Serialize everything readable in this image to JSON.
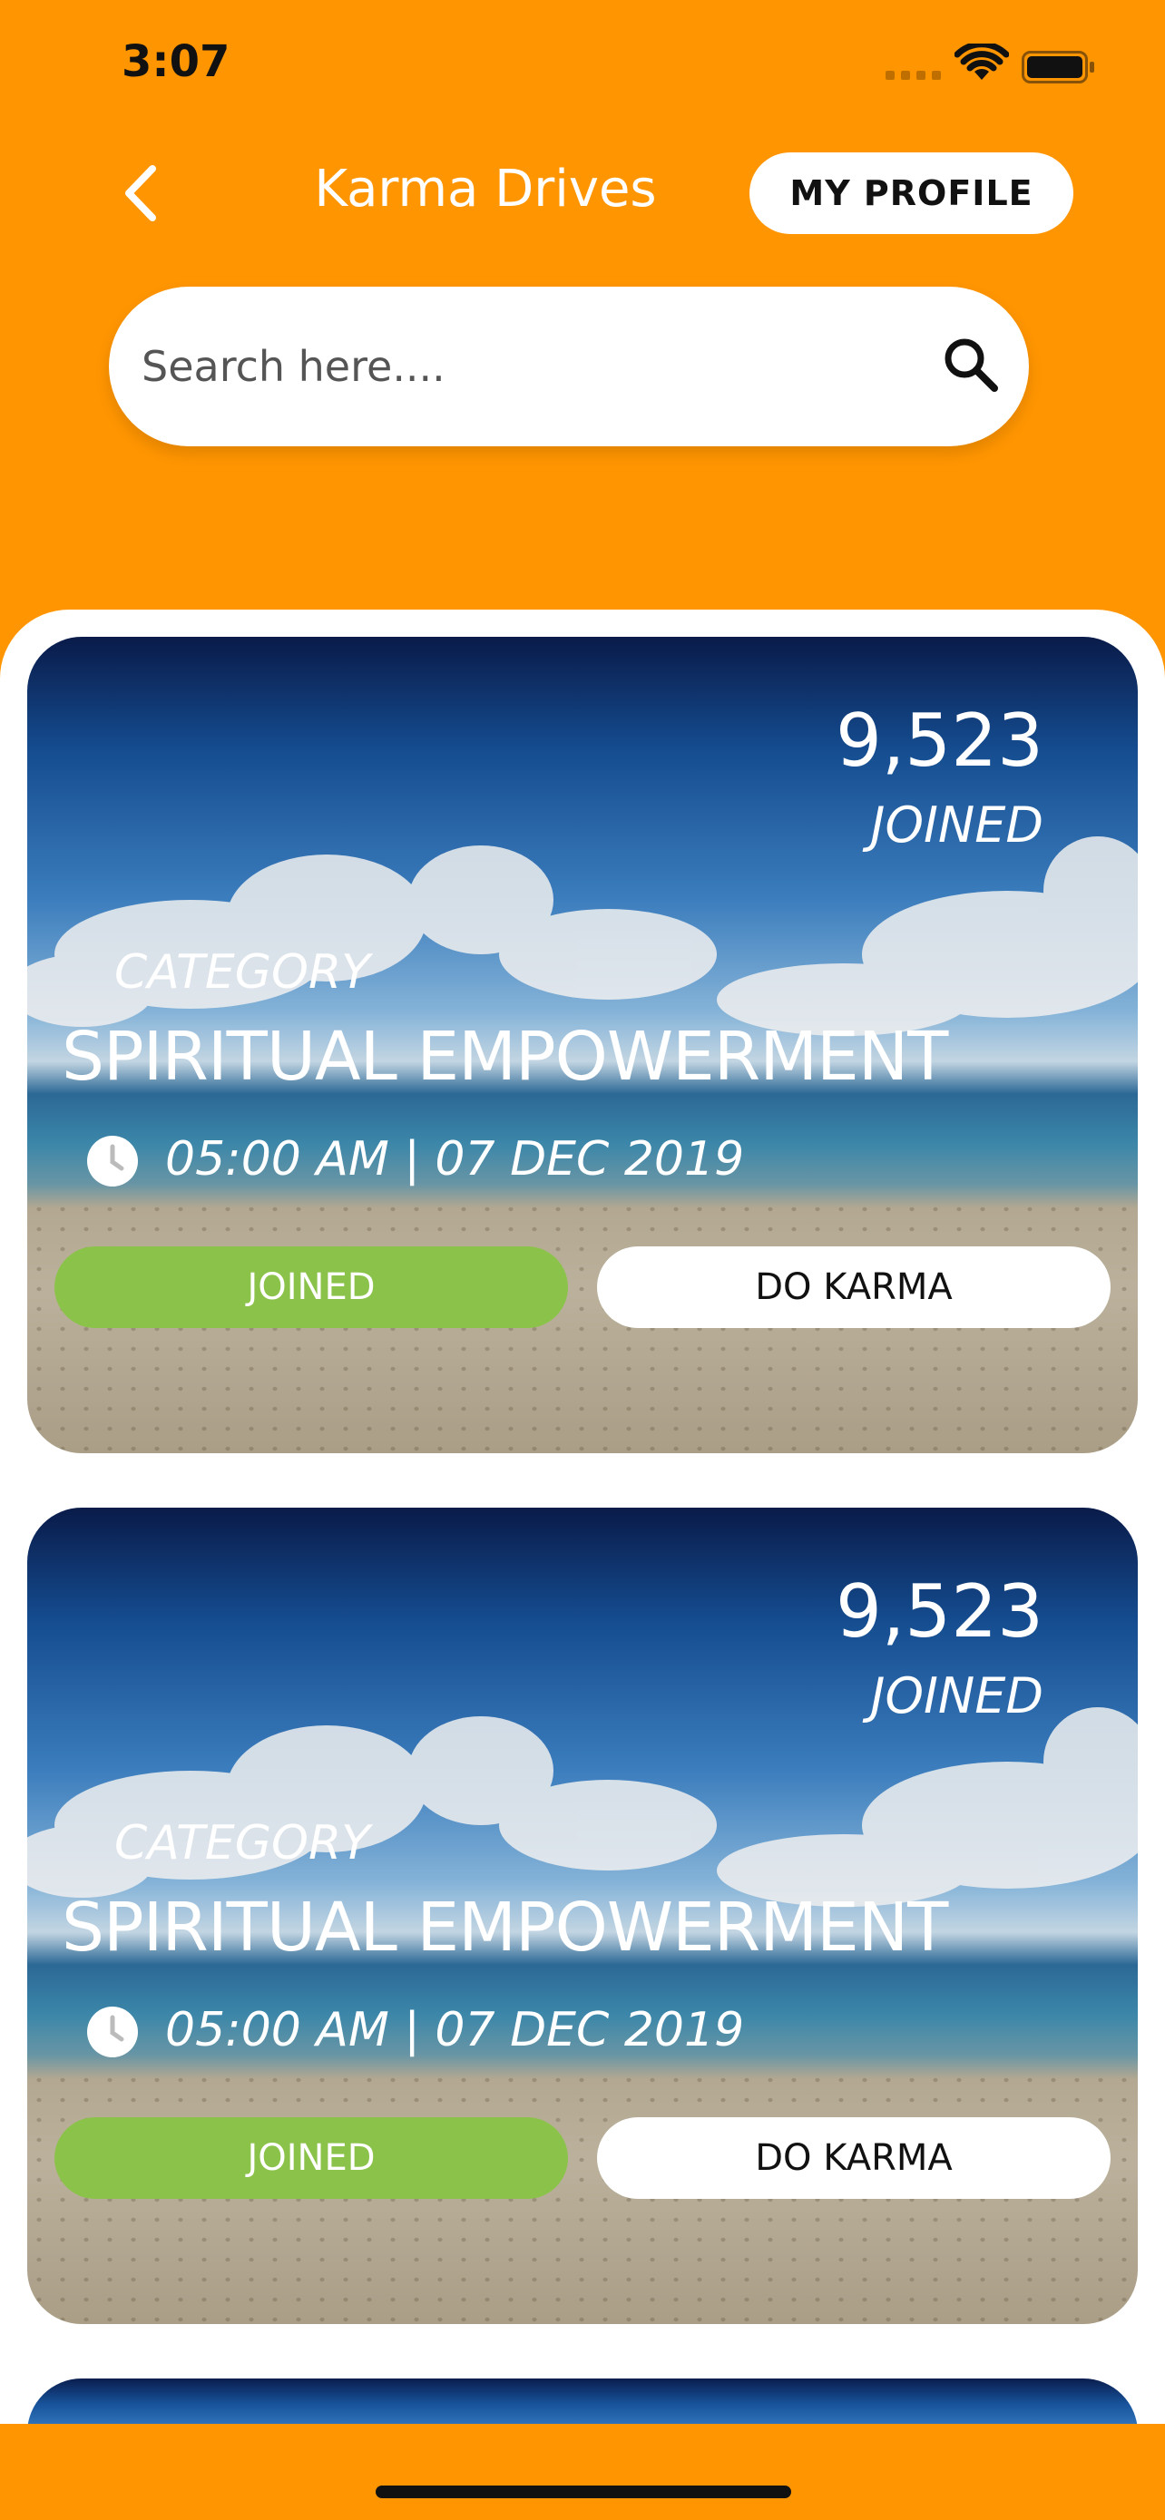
{
  "status_bar": {
    "time": "3:07"
  },
  "header": {
    "title": "Karma Drives",
    "profile_label": "MY PROFILE"
  },
  "search": {
    "placeholder": "Search here...."
  },
  "cards": [
    {
      "count": "9,523",
      "joined_label": "JOINED",
      "category": "CATEGORY",
      "title": "SPIRITUAL EMPOWERMENT",
      "time": "05:00 AM  |  07 DEC 2019",
      "joined_button": "JOINED",
      "karma_button": "DO KARMA"
    },
    {
      "count": "9,523",
      "joined_label": "JOINED",
      "category": "CATEGORY",
      "title": "SPIRITUAL EMPOWERMENT",
      "time": "05:00 AM  |  07 DEC 2019",
      "joined_button": "JOINED",
      "karma_button": "DO KARMA"
    }
  ],
  "colors": {
    "accent": "#FF9500",
    "joined_green": "#8BC34A"
  },
  "icons": {
    "back": "chevron-left-icon",
    "search": "search-icon",
    "clock": "clock-icon",
    "wifi": "wifi-icon",
    "battery": "battery-icon"
  }
}
